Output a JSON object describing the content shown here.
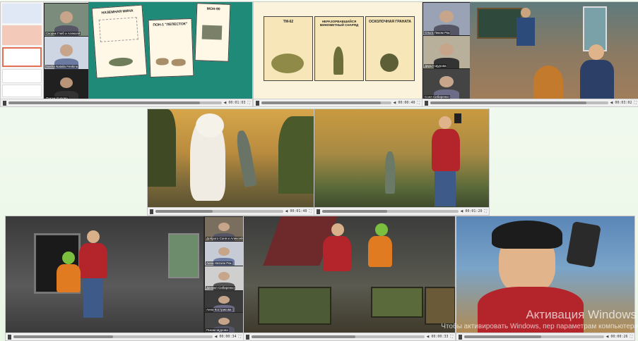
{
  "participants": {
    "p1": "Скорик Глеб и Алексей",
    "p2": "Sasha Natalia Fenkina",
    "p3": "Пикэм Щурова",
    "p4": "Ольга Пикэм Рак",
    "p5": "Дарья Щурова",
    "p6": "Пикэм Щурова",
    "p7": "Соня Сибиренко",
    "p8": "Доброго Соня и Алексей",
    "p9": "Анна Натали Рак",
    "p10": "Даниил Сибиренко",
    "p11": "Анна Кострикова"
  },
  "slides": {
    "mine_card_1": "НАЗЕМНАЯ МИНА",
    "mine_card_2": "ПОН-1 \"ЛЕПЕСТОК\"",
    "mine_card_3": "МОН-90",
    "ammo_1": "ТМ-62",
    "ammo_2": "НЕРАЗОРВАВШИЙСЯ МИНОМЕТНЫЙ СНАРЯД",
    "ammo_3": "ОСКОЛОЧНАЯ ГРАНАТА"
  },
  "players": [
    {
      "time": "00:01:03",
      "progress": 0.9
    },
    {
      "time": "00:00:40",
      "progress": 0.92
    },
    {
      "time": "00:03:02",
      "progress": 0.88
    },
    {
      "time": "00:01:40",
      "progress": 0.45
    },
    {
      "time": "00:01:20",
      "progress": 0.48
    },
    {
      "time": "00:00:34",
      "progress": 0.5
    },
    {
      "time": "00:00:33",
      "progress": 0.6
    },
    {
      "time": "00:00:26",
      "progress": 0.55
    }
  ],
  "watermark": {
    "line1": "Активация Windows",
    "line2": "Чтобы активировать Windows, пер параметрам компьютера"
  }
}
